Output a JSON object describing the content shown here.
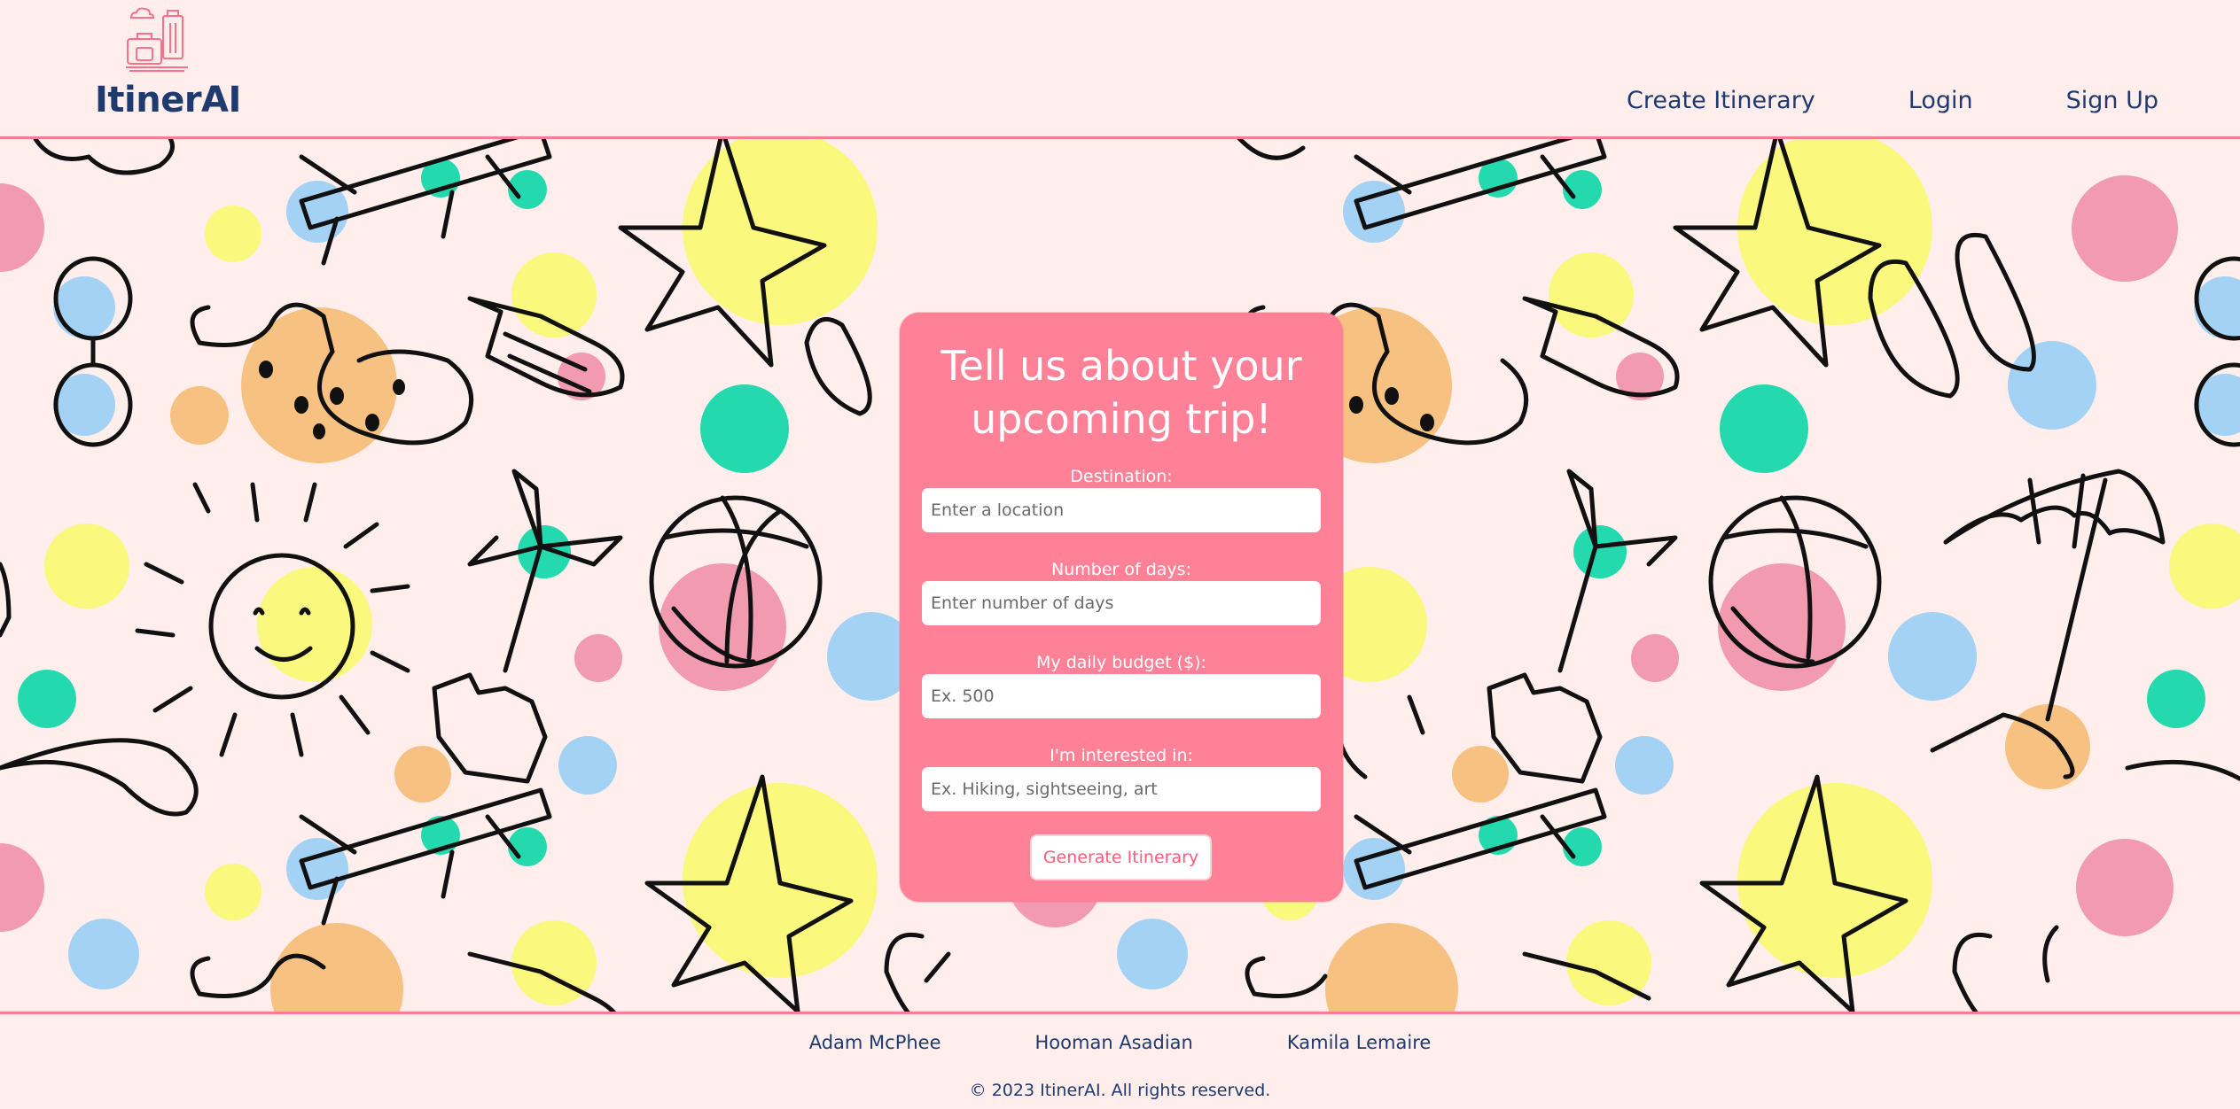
{
  "brand": {
    "name": "ItinerAI",
    "logo_icon": "luggage-icon",
    "logo_color": "#ff6f8a"
  },
  "nav": {
    "items": [
      {
        "label": "Create Itinerary"
      },
      {
        "label": "Login"
      },
      {
        "label": "Sign Up"
      }
    ]
  },
  "form": {
    "title_line1": "Tell us about your",
    "title_line2": "upcoming trip!",
    "fields": [
      {
        "label": "Destination:",
        "placeholder": "Enter a location",
        "value": ""
      },
      {
        "label": "Number of days:",
        "placeholder": "Enter number of days",
        "value": ""
      },
      {
        "label": "My daily budget ($):",
        "placeholder": "Ex. 500",
        "value": ""
      },
      {
        "label": "I'm interested in:",
        "placeholder": "Ex. Hiking, sightseeing, art",
        "value": ""
      }
    ],
    "submit_label": "Generate Itinerary"
  },
  "footer": {
    "authors": [
      "Adam McPhee",
      "Hooman Asadian",
      "Kamila Lemaire"
    ],
    "copyright": "© 2023 ItinerAI. All rights reserved."
  },
  "colors": {
    "background": "#ffeeec",
    "accent": "#ff8197",
    "brand_text": "#1f3a6e",
    "dot_yellow": "#fbf87e",
    "dot_pink": "#f29ab0",
    "dot_blue": "#a4d2f5",
    "dot_teal": "#23d9ad",
    "dot_orange": "#f7c281"
  }
}
